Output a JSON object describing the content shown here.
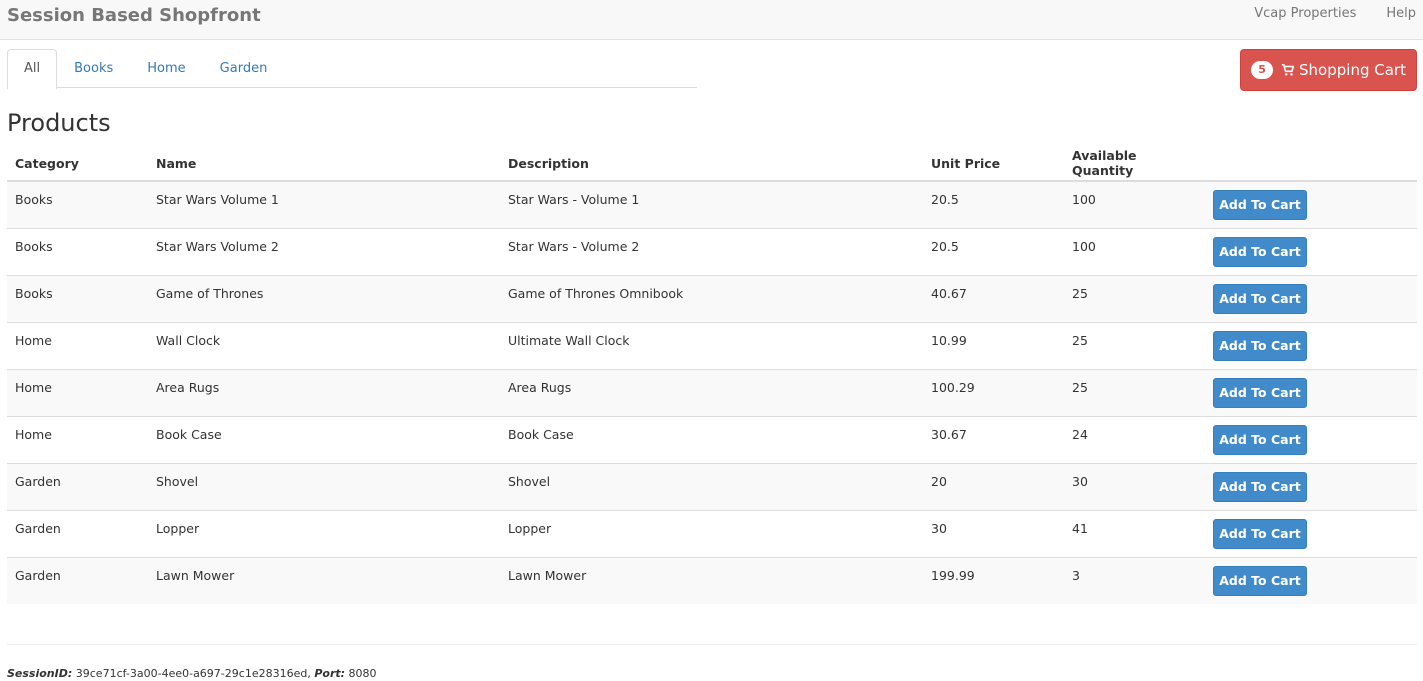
{
  "navbar": {
    "brand": "Session Based Shopfront",
    "links": [
      "Vcap Properties",
      "Help"
    ]
  },
  "tabs": [
    {
      "label": "All",
      "active": true
    },
    {
      "label": "Books",
      "active": false
    },
    {
      "label": "Home",
      "active": false
    },
    {
      "label": "Garden",
      "active": false
    }
  ],
  "cart": {
    "count": "5",
    "label": "Shopping Cart",
    "icon": "shopping-cart-icon",
    "color": "#d9534f"
  },
  "products": {
    "title": "Products",
    "columns": [
      "Category",
      "Name",
      "Description",
      "Unit Price",
      "Available Quantity"
    ],
    "add_label": "Add To Cart",
    "rows": [
      {
        "category": "Books",
        "name": "Star Wars Volume 1",
        "description": "Star Wars - Volume 1",
        "price": "20.5",
        "qty": "100"
      },
      {
        "category": "Books",
        "name": "Star Wars Volume 2",
        "description": "Star Wars - Volume 2",
        "price": "20.5",
        "qty": "100"
      },
      {
        "category": "Books",
        "name": "Game of Thrones",
        "description": "Game of Thrones Omnibook",
        "price": "40.67",
        "qty": "25"
      },
      {
        "category": "Home",
        "name": "Wall Clock",
        "description": "Ultimate Wall Clock",
        "price": "10.99",
        "qty": "25"
      },
      {
        "category": "Home",
        "name": "Area Rugs",
        "description": "Area Rugs",
        "price": "100.29",
        "qty": "25"
      },
      {
        "category": "Home",
        "name": "Book Case",
        "description": "Book Case",
        "price": "30.67",
        "qty": "24"
      },
      {
        "category": "Garden",
        "name": "Shovel",
        "description": "Shovel",
        "price": "20",
        "qty": "30"
      },
      {
        "category": "Garden",
        "name": "Lopper",
        "description": "Lopper",
        "price": "30",
        "qty": "41"
      },
      {
        "category": "Garden",
        "name": "Lawn Mower",
        "description": "Lawn Mower",
        "price": "199.99",
        "qty": "3"
      }
    ]
  },
  "footer": {
    "session_label": "SessionID:",
    "session_id": "39ce71cf-3a00-4ee0-a697-29c1e28316ed",
    "port_label": "Port:",
    "port": "8080"
  },
  "colors": {
    "primary": "#428bca",
    "link": "#337ab7"
  }
}
